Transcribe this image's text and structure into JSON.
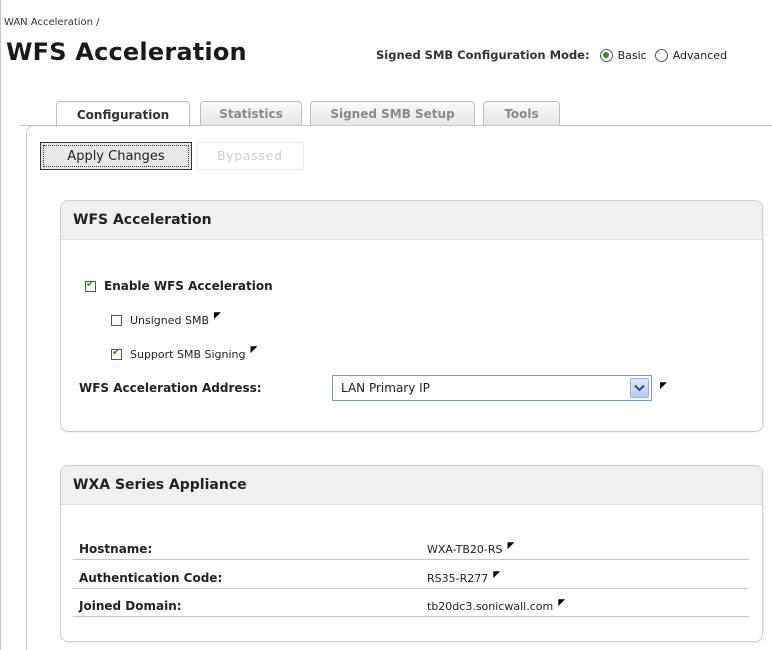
{
  "breadcrumb": "WAN Acceleration /",
  "page_title": "WFS Acceleration",
  "mode": {
    "label": "Signed SMB Configuration Mode:",
    "options": [
      "Basic",
      "Advanced"
    ],
    "selected": "Basic"
  },
  "tabs": [
    {
      "label": "Configuration",
      "active": true
    },
    {
      "label": "Statistics",
      "active": false
    },
    {
      "label": "Signed SMB Setup",
      "active": false
    },
    {
      "label": "Tools",
      "active": false
    }
  ],
  "actions": {
    "apply": "Apply Changes",
    "bypassed": "Bypassed"
  },
  "wfs_panel": {
    "title": "WFS Acceleration",
    "enable": {
      "label": "Enable WFS Acceleration",
      "checked": true
    },
    "unsigned_smb": {
      "label": "Unsigned SMB",
      "checked": false
    },
    "support_signing": {
      "label": "Support SMB Signing",
      "checked": true
    },
    "address": {
      "label": "WFS Acceleration Address:",
      "value": "LAN Primary IP"
    }
  },
  "wxa_panel": {
    "title": "WXA Series Appliance",
    "rows": [
      {
        "label": "Hostname:",
        "value": "WXA-TB20-RS"
      },
      {
        "label": "Authentication Code:",
        "value": "RS35-R277"
      },
      {
        "label": "Joined Domain:",
        "value": "tb20dc3.sonicwall.com"
      }
    ]
  },
  "tick_glyph": "◤",
  "colors": {
    "accent_check": "#2f8a1f",
    "radio_dot": "#3a8a2a",
    "select_border": "#7f9db9"
  }
}
